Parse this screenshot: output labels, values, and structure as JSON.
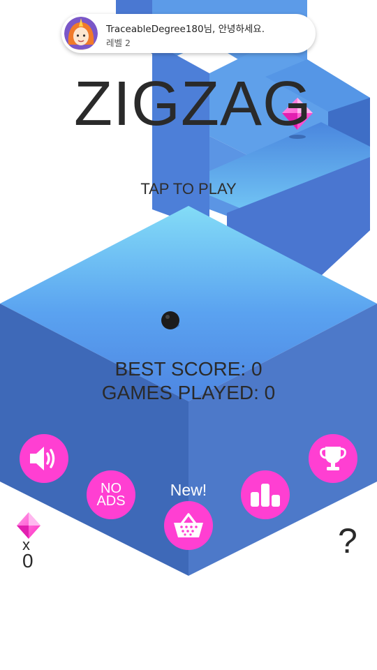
{
  "notification": {
    "username": "TraceableDegree180님, 안녕하세요.",
    "level": "레벨 2",
    "avatar_icon": "unicorn-avatar-icon"
  },
  "title": "ZIGZAG",
  "tap_to_play": "TAP TO PLAY",
  "stats": {
    "best_score": "BEST SCORE: 0",
    "games_played": "GAMES PLAYED: 0"
  },
  "buttons": {
    "sound_icon": "speaker-icon",
    "no_ads_line1": "NO",
    "no_ads_line2": "ADS",
    "shop_badge": "New!",
    "shop_icon": "basket-icon",
    "leaderboard_icon": "leaderboard-icon",
    "achievements_icon": "trophy-icon"
  },
  "gems": {
    "icon": "gem-icon",
    "multiplier": "x",
    "count": "0"
  },
  "help": "?",
  "colors": {
    "accent": "#ff3fd2",
    "platform_top": "#5b9cf0",
    "platform_side": "#3f67b8",
    "path_top": "#6db8f5",
    "path_side": "#4a7fd8",
    "background": "#ffffff",
    "text": "#2a2a2a"
  }
}
